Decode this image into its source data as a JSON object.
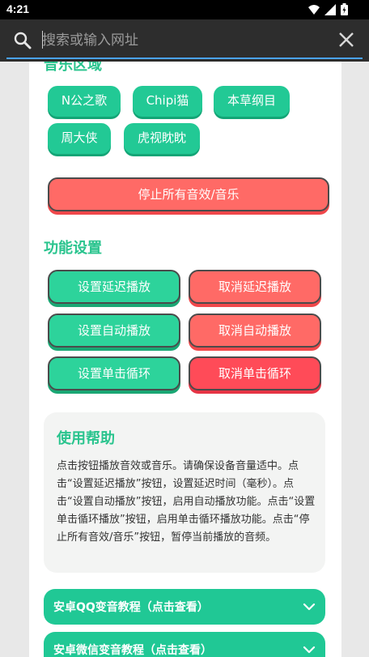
{
  "status_bar": {
    "time": "4:21",
    "icons": [
      "wifi-icon",
      "cellular-signal-icon",
      "battery-icon"
    ]
  },
  "address_bar": {
    "placeholder": "搜索或输入网址",
    "icons": [
      "search-icon",
      "close-icon"
    ]
  },
  "music_section": {
    "title": "音乐区域",
    "songs": [
      "N公之歌",
      "Chipi猫",
      "本草纲目",
      "周大侠",
      "虎视眈眈"
    ],
    "stop_all_label": "停止所有音效/音乐"
  },
  "settings_section": {
    "title": "功能设置",
    "set_delay": "设置延迟播放",
    "cancel_delay": "取消延迟播放",
    "set_auto": "设置自动播放",
    "cancel_auto": "取消自动播放",
    "set_loop": "设置单击循环",
    "cancel_loop": "取消单击循环"
  },
  "help": {
    "title": "使用帮助",
    "body": "点击按钮播放音效或音乐。请确保设备音量适中。点击“设置延迟播放”按钮，设置延迟时间（毫秒）。点击“设置自动播放”按钮，启用自动播放功能。点击“设置单击循环播放”按钮，启用单击循环播放功能。点击“停止所有音效/音乐”按钮，暂停当前播放的音频。"
  },
  "tutorials": [
    {
      "label": "安卓QQ变音教程（点击查看）"
    },
    {
      "label": "安卓微信变音教程（点击查看）"
    }
  ],
  "colors": {
    "accent_green": "#22c995",
    "stop_red": "#ff6a66",
    "title_green": "#2ac48e"
  }
}
